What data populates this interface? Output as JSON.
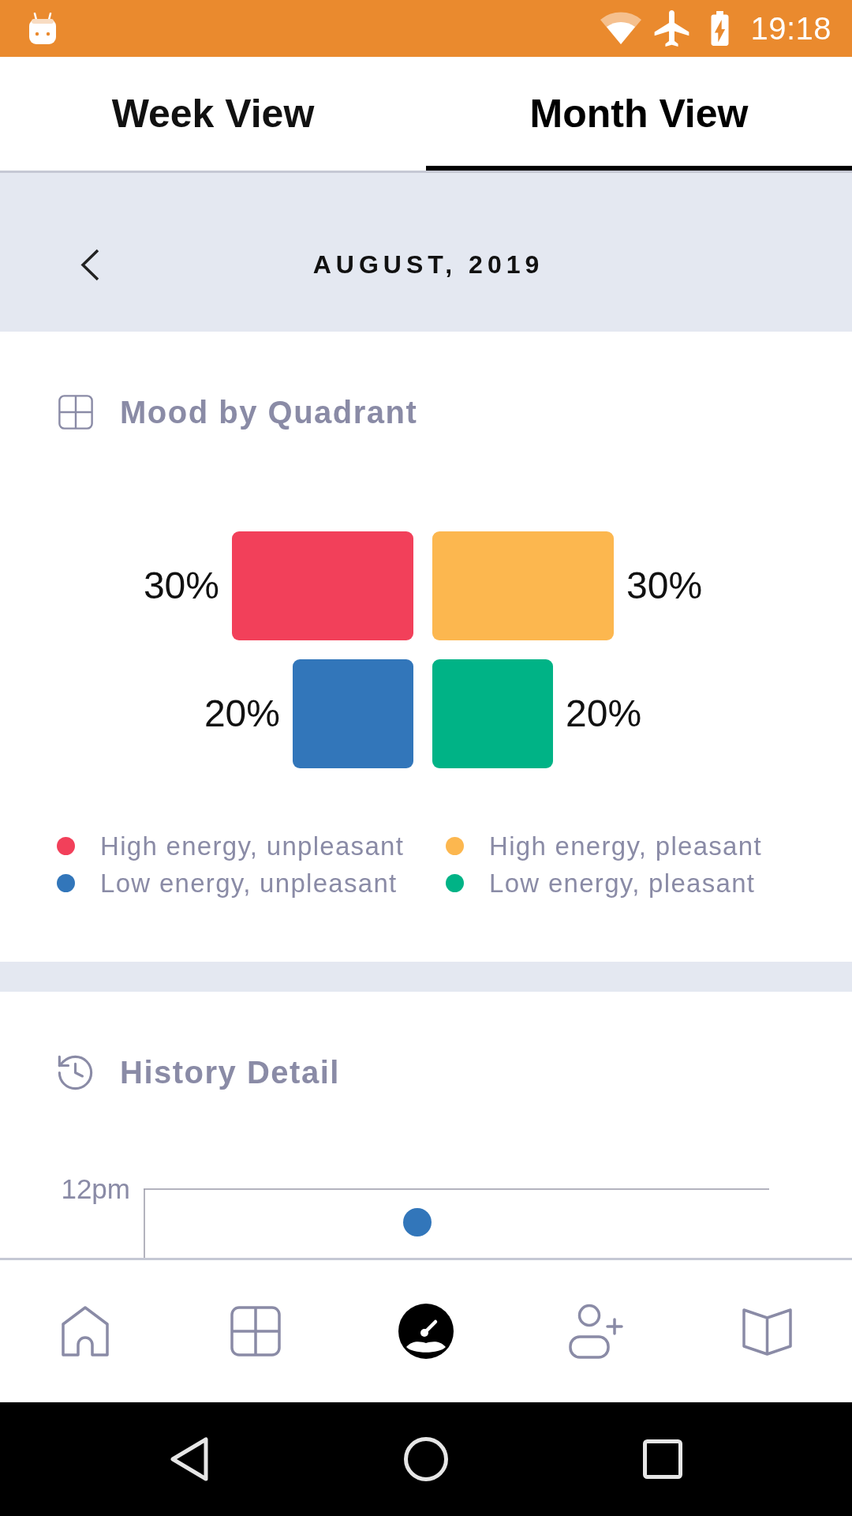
{
  "status_bar": {
    "time": "19:18"
  },
  "tabs": [
    {
      "label": "Week View",
      "selected": false
    },
    {
      "label": "Month View",
      "selected": true
    }
  ],
  "date_header": {
    "title": "AUGUST, 2019"
  },
  "mood_by_quadrant": {
    "title": "Mood by Quadrant",
    "quadrants": [
      {
        "name": "High energy, unpleasant",
        "color": "#f2405a",
        "share": "30%",
        "kind": "large"
      },
      {
        "name": "High energy, pleasant",
        "color": "#fcb74f",
        "share": "30%",
        "kind": "large"
      },
      {
        "name": "Low energy, unpleasant",
        "color": "#3276ba",
        "share": "20%",
        "kind": "small"
      },
      {
        "name": "Low energy, pleasant",
        "color": "#00b386",
        "share": "20%",
        "kind": "small"
      }
    ]
  },
  "history_detail": {
    "title": "History Detail",
    "y_axis_label": "12pm"
  },
  "bottom_nav": [
    {
      "selected": false
    },
    {
      "selected": false
    },
    {
      "selected": true
    },
    {
      "selected": false
    },
    {
      "selected": false
    }
  ]
}
